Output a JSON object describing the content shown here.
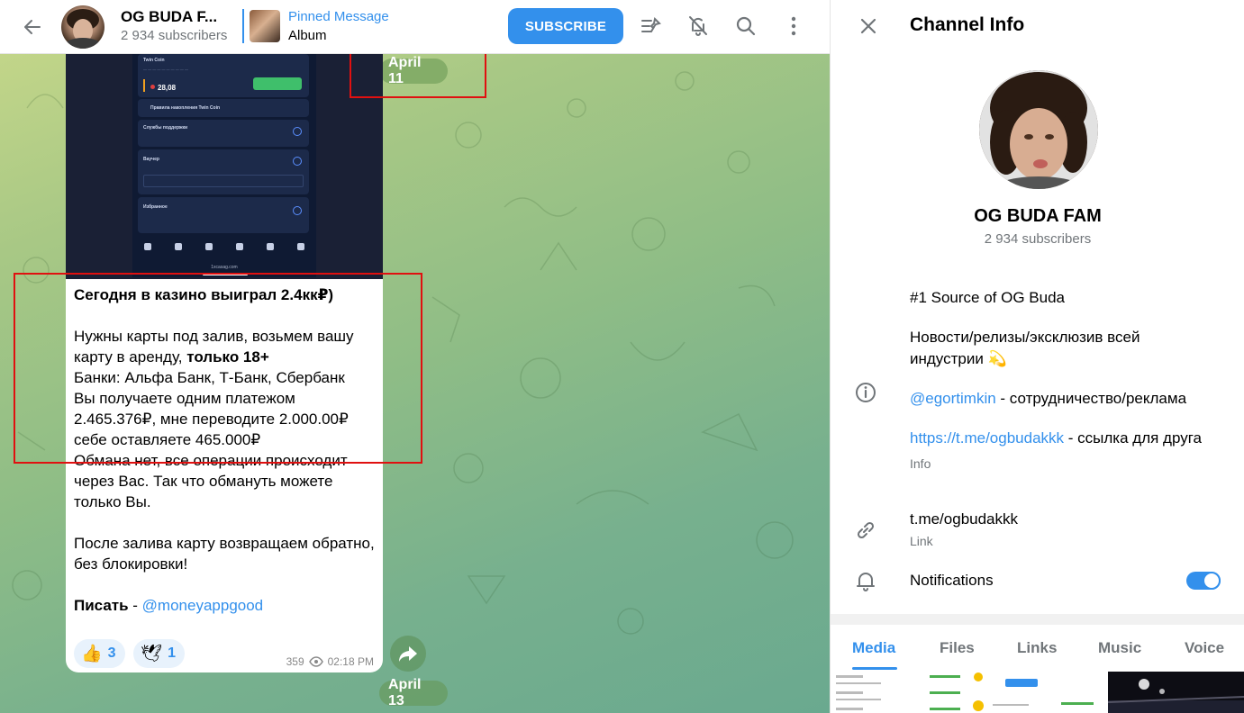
{
  "header": {
    "channel_name": "OG BUDA F...",
    "subscribers": "2 934 subscribers",
    "pinned_title": "Pinned Message",
    "pinned_text": "Album",
    "subscribe_label": "SUBSCRIBE"
  },
  "dates": {
    "top": "April 11",
    "bottom": "April 13"
  },
  "phone_screenshot": {
    "card1_title": "Twin Coin",
    "card1_value": "28,08",
    "card2_title": "Правила накопления Twin Coin",
    "card3_title": "Службы поддержки",
    "card4_title": "Ваучер",
    "card5_title": "Избранное",
    "url": "1xcasag.com"
  },
  "message": {
    "headline": "Сегодня в казино выиграл 2.4кк₽)",
    "line1": "Нужны карты под залив, возьмем вашу карту в аренду, ",
    "line1_bold": "только 18+",
    "line2": "Банки: Альфа Банк, Т-Банк, Сбербанк",
    "line3": "Вы получаете одним платежом 2.465.376₽, мне переводите 2.000.00₽ себе оставляете 465.000₽",
    "line4": "Обмана нет, все операции происходит через Вас. Так что обмануть можете только Вы.",
    "line5": "После залива карту возвращаем обратно, без блокировки!",
    "contact_label": "Писать",
    "contact_sep": " - ",
    "contact_link": "@moneyappgood",
    "reactions": [
      {
        "emoji": "👍",
        "count": "3"
      },
      {
        "emoji": "🕊",
        "count": "1"
      }
    ],
    "views": "359",
    "time": "02:18 PM"
  },
  "info_panel": {
    "title": "Channel Info",
    "name": "OG BUDA FAM",
    "subscribers": "2 934 subscribers",
    "desc1": "#1 Source of OG Buda",
    "desc2": "Новости/релизы/эксклюзив всей индустрии 💫",
    "desc3_link": "@egortimkin",
    "desc3_text": " - сотрудничество/реклама",
    "desc4_link": "https://t.me/ogbudakkk",
    "desc4_text": " -  ссылка для друга",
    "desc_caption": "Info",
    "link": "t.me/ogbudakkk",
    "link_caption": "Link",
    "notifications": "Notifications",
    "notifications_on": true,
    "tabs": [
      "Media",
      "Files",
      "Links",
      "Music",
      "Voice"
    ],
    "active_tab": "Media"
  },
  "colors": {
    "accent": "#3390ec",
    "annotation": "#e01010"
  }
}
